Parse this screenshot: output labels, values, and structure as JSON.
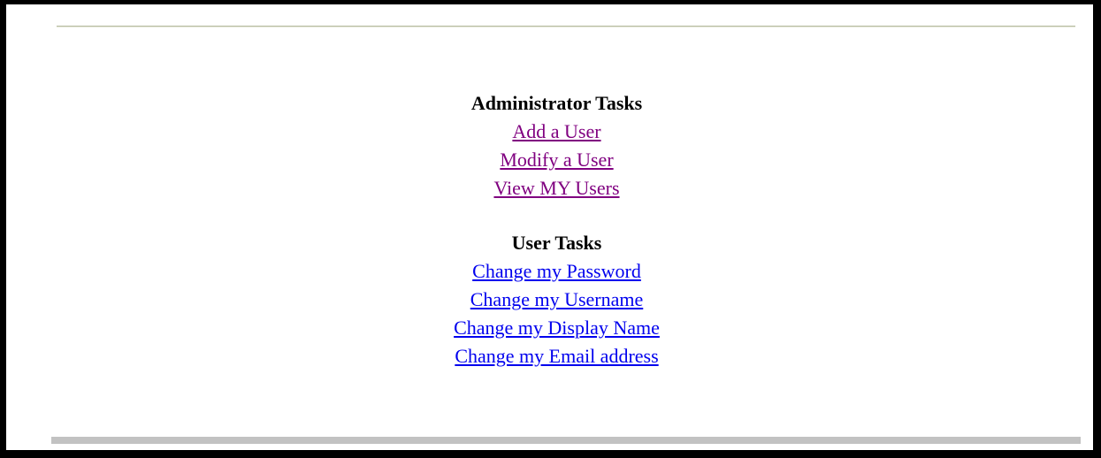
{
  "admin_section": {
    "heading": "Administrator Tasks",
    "links": [
      {
        "label": "Add a User",
        "visited": true
      },
      {
        "label": "Modify a User",
        "visited": true
      },
      {
        "label": "View MY Users",
        "visited": true
      }
    ]
  },
  "user_section": {
    "heading": "User Tasks",
    "links": [
      {
        "label": "Change my Password",
        "visited": false
      },
      {
        "label": "Change my Username",
        "visited": false
      },
      {
        "label": "Change my Display Name",
        "visited": false
      },
      {
        "label": "Change my Email address",
        "visited": false
      }
    ]
  },
  "colors": {
    "frame_border": "#000000",
    "visited_link": "#800080",
    "unvisited_link": "#0000ee",
    "bottom_bar": "#c2c2c2",
    "top_rule": "#b7bca0"
  }
}
